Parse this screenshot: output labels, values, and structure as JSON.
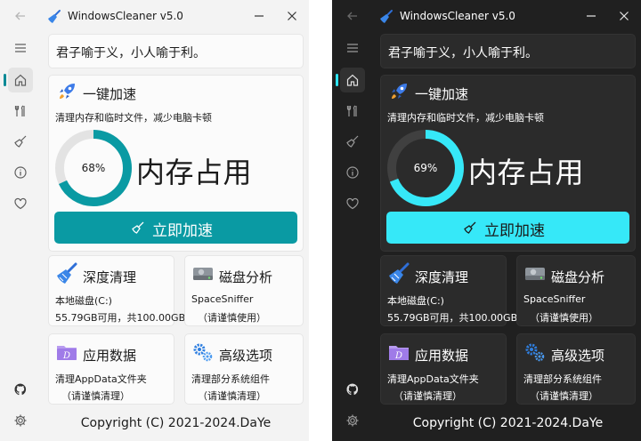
{
  "app": {
    "title": "WindowsCleaner v5.0"
  },
  "quote": "君子喻于义，小人喻于利。",
  "boost": {
    "title": "一键加速",
    "description": "清理内存和临时文件，减少电脑卡顿",
    "memory_label": "内存占用",
    "button_label": "立即加速"
  },
  "features": {
    "deep_clean": {
      "title": "深度清理",
      "line1": "本地磁盘(C:)",
      "line2": "55.79GB可用，共100.00GB"
    },
    "disk_analysis": {
      "title": "磁盘分析",
      "line1": "SpaceSniffer",
      "line2": "（请谨慎使用）"
    },
    "app_data": {
      "title": "应用数据",
      "line1": "清理AppData文件夹",
      "line2": "（请谨慎清理）"
    },
    "advanced": {
      "title": "高级选项",
      "line1": "清理部分系统组件",
      "line2": "（请谨慎清理）"
    }
  },
  "copyright": "Copyright (C) 2021-2024.DaYe",
  "light": {
    "memory_percent": 68,
    "memory_text": "68%"
  },
  "dark": {
    "memory_percent": 69,
    "memory_text": "69%"
  },
  "colors": {
    "light_accent": "#0a9aa3",
    "dark_accent": "#36e8f8",
    "light_bg": "#f3f3f3",
    "dark_bg": "#202020"
  },
  "icons": {
    "back": "arrow-left-icon",
    "app": "broom-icon",
    "minimize": "minimize-icon",
    "close": "close-icon",
    "menu": "menu-icon",
    "home": "home-icon",
    "tools": "tools-icon",
    "clean": "broom-icon",
    "info": "info-icon",
    "favorite": "heart-icon",
    "github": "github-icon",
    "settings": "gear-icon"
  }
}
